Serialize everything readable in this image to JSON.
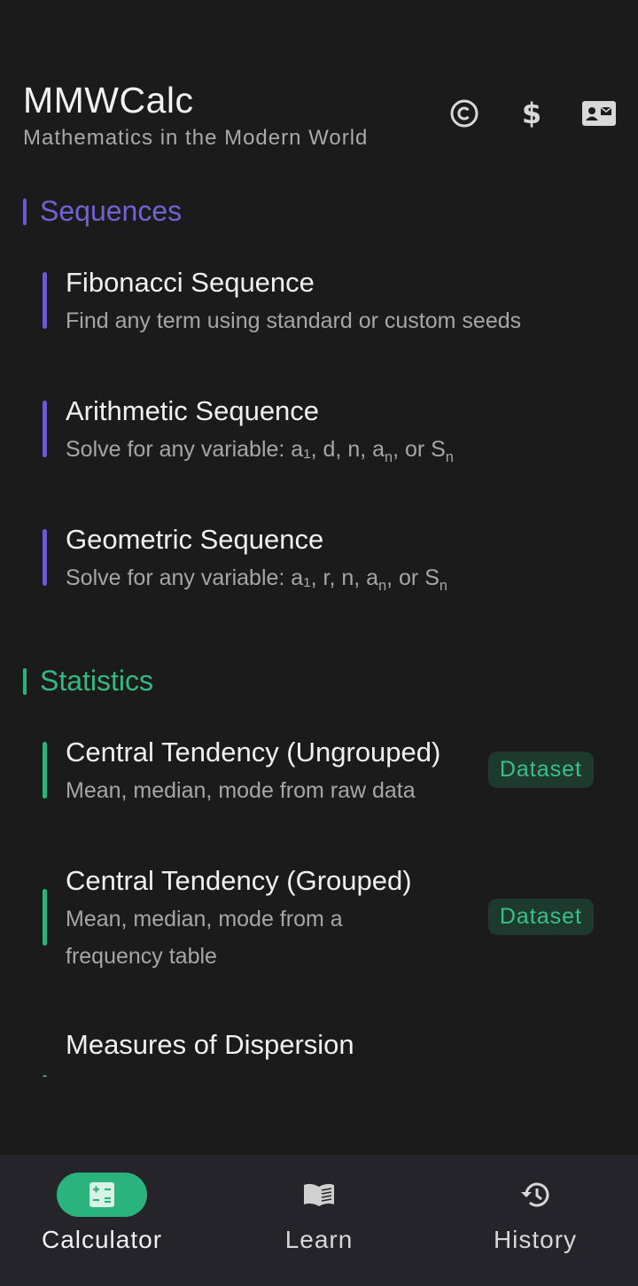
{
  "app": {
    "title": "MMWCalc",
    "subtitle": "Mathematics in the Modern World"
  },
  "header_icons": [
    "copyright-icon",
    "dollar-icon",
    "contact-card-icon"
  ],
  "sections": {
    "sequences": {
      "title": "Sequences",
      "color": "#6a5bd3",
      "items": [
        {
          "label": "Fibonacci Sequence",
          "desc": "Find any term using standard or custom seeds"
        },
        {
          "label": "Arithmetic Sequence",
          "desc_prefix": "Solve for any variable: a₁, d, n, a",
          "desc_sub1": "n",
          "desc_mid": ", or S",
          "desc_sub2": "n"
        },
        {
          "label": "Geometric Sequence",
          "desc_prefix": "Solve for any variable: a₁, r, n, a",
          "desc_sub1": "n",
          "desc_mid": ", or S",
          "desc_sub2": "n"
        }
      ]
    },
    "statistics": {
      "title": "Statistics",
      "color": "#2bb37d",
      "items": [
        {
          "label": "Central Tendency (Ungrouped)",
          "desc": "Mean, median, mode from raw data",
          "badge": "Dataset"
        },
        {
          "label": "Central Tendency (Grouped)",
          "desc_line1": "Mean, median, mode from a",
          "desc_line2": "frequency table",
          "badge": "Dataset"
        },
        {
          "label": "Measures of Dispersion"
        }
      ]
    }
  },
  "nav": {
    "items": [
      {
        "label": "Calculator",
        "icon": "calculator-icon",
        "active": true
      },
      {
        "label": "Learn",
        "icon": "book-icon",
        "active": false
      },
      {
        "label": "History",
        "icon": "history-icon",
        "active": false
      }
    ]
  }
}
